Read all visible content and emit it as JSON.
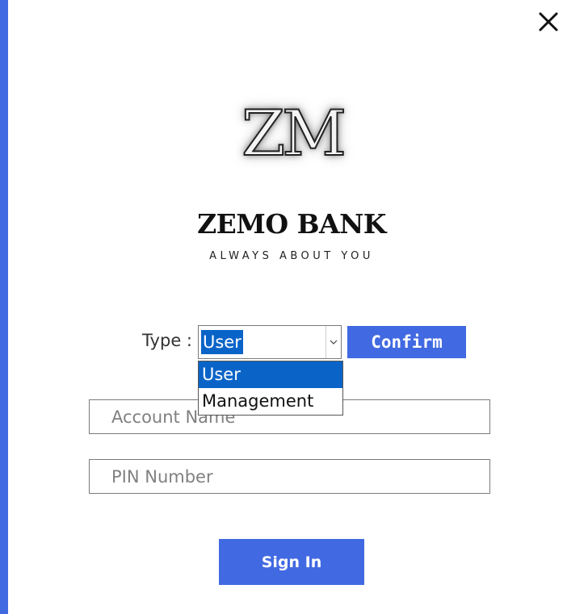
{
  "brand": {
    "logo_mark": "ZM",
    "name": "ZEMO BANK",
    "tagline": "ALWAYS ABOUT YOU"
  },
  "icons": {
    "close": "close-icon",
    "dropdown_arrow": "chevron-down-icon"
  },
  "login_form": {
    "type_label": "Type :",
    "type_select": {
      "selected_value": "User",
      "options": [
        "User",
        "Management"
      ],
      "highlighted_option": "User"
    },
    "confirm_label": "Confirm",
    "account_name_placeholder": "Account Name",
    "pin_placeholder": "PIN Number",
    "sign_in_label": "Sign In"
  },
  "colors": {
    "accent": "#4169e1",
    "selection": "#0a64c8"
  }
}
